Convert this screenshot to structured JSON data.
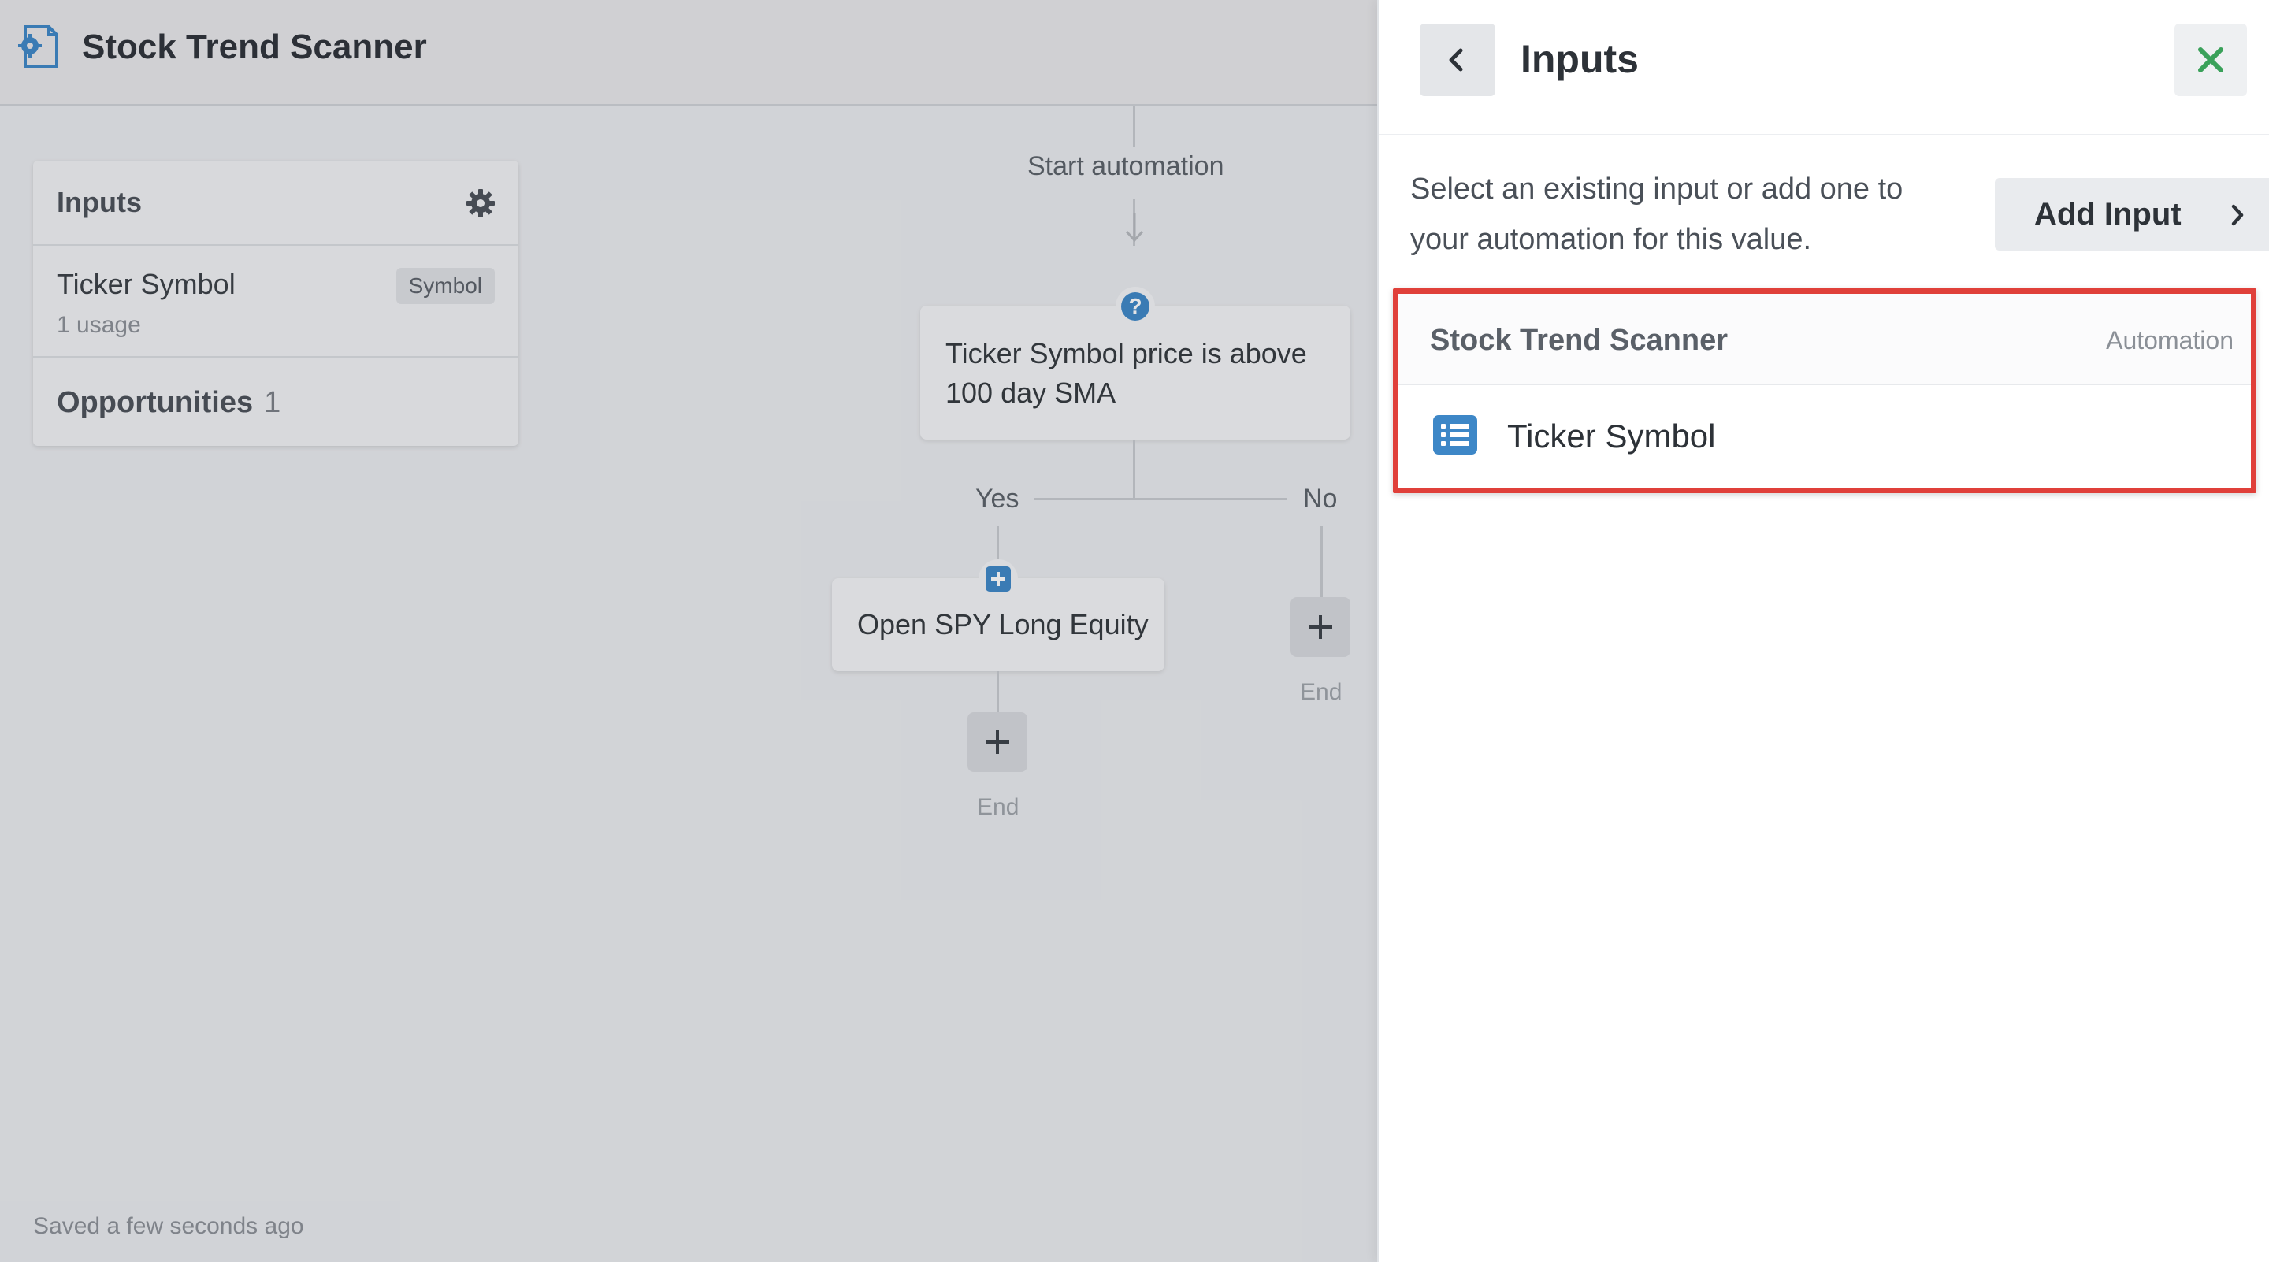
{
  "header": {
    "app_title": "Stock Trend Scanner",
    "logo_icon": "automation-gear-document-icon"
  },
  "inputs_card": {
    "title": "Inputs",
    "settings_icon": "gear-icon",
    "items": [
      {
        "label": "Ticker Symbol",
        "type_badge": "Symbol",
        "usage": "1 usage"
      }
    ],
    "opportunities_label": "Opportunities",
    "opportunities_count": "1"
  },
  "flow": {
    "start_label": "Start automation",
    "condition_text": "Ticker Symbol price is above 100 day SMA",
    "yes_label": "Yes",
    "no_label": "No",
    "action_text": "Open SPY Long Equity",
    "end_label_left": "End",
    "end_label_right": "End"
  },
  "status": {
    "saved_text": "Saved a few seconds ago"
  },
  "panel": {
    "title": "Inputs",
    "helper_text": "Select an existing input or add one to your automation for this value.",
    "add_input_label": "Add Input",
    "group": {
      "title": "Stock Trend Scanner",
      "tag": "Automation",
      "items": [
        {
          "label": "Ticker Symbol",
          "icon": "list-icon"
        }
      ]
    }
  },
  "colors": {
    "accent_blue": "#3d87c7",
    "close_green": "#3aa15a",
    "highlight_red": "#e0403a"
  }
}
